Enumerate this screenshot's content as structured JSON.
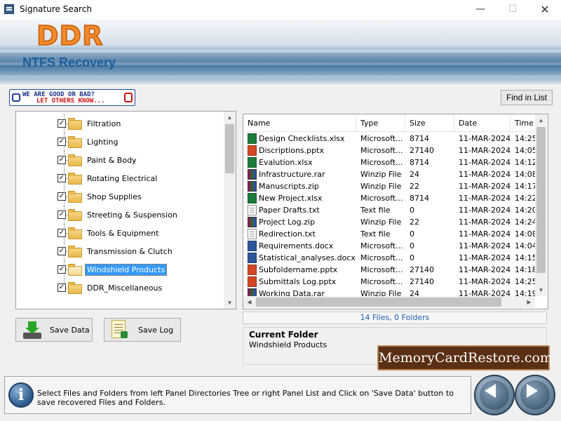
{
  "window": {
    "title": "Signature Search",
    "controls": {
      "minimize": "—",
      "maximize": "☐",
      "close": "✕"
    }
  },
  "banner": {
    "logo": "DDR",
    "subtitle": "NTFS Recovery"
  },
  "feedback": {
    "line1": "WE ARE GOOD OR BAD?",
    "line2": "LET OTHERS KNOW..."
  },
  "toolbar": {
    "find_label": "Find in List"
  },
  "tree": {
    "items": [
      {
        "label": "Filtration",
        "checked": true,
        "selected": false
      },
      {
        "label": "Lighting",
        "checked": true,
        "selected": false
      },
      {
        "label": "Paint & Body",
        "checked": true,
        "selected": false
      },
      {
        "label": "Rotating Electrical",
        "checked": true,
        "selected": false
      },
      {
        "label": "Shop Supplies",
        "checked": true,
        "selected": false
      },
      {
        "label": "Streeting & Suspension",
        "checked": true,
        "selected": false
      },
      {
        "label": "Tools & Equipment",
        "checked": true,
        "selected": false
      },
      {
        "label": "Transmission & Clutch",
        "checked": true,
        "selected": false
      },
      {
        "label": "Windshield Products",
        "checked": true,
        "selected": true
      },
      {
        "label": "DDR_Miscellaneous",
        "checked": true,
        "selected": false
      }
    ]
  },
  "file_list": {
    "columns": [
      "Name",
      "Type",
      "Size",
      "Date",
      "Time"
    ],
    "rows": [
      {
        "icon": "xlsx",
        "name": "Design Checklists.xlsx",
        "type": "Microsoft...",
        "size": "8714",
        "date": "11-MAR-2024",
        "time": "14:25"
      },
      {
        "icon": "pptx",
        "name": "Discriptions.pptx",
        "type": "Microsoft...",
        "size": "27140",
        "date": "11-MAR-2024",
        "time": "14:05"
      },
      {
        "icon": "xlsx",
        "name": "Evalution.xlsx",
        "type": "Microsoft...",
        "size": "8714",
        "date": "11-MAR-2024",
        "time": "14:12"
      },
      {
        "icon": "rar",
        "name": "Infrastructure.rar",
        "type": "Winzip File",
        "size": "24",
        "date": "11-MAR-2024",
        "time": "14:08"
      },
      {
        "icon": "zip",
        "name": "Manuscripts.zip",
        "type": "Winzip File",
        "size": "22",
        "date": "11-MAR-2024",
        "time": "14:17"
      },
      {
        "icon": "xlsx",
        "name": "New Project.xlsx",
        "type": "Microsoft...",
        "size": "8714",
        "date": "11-MAR-2024",
        "time": "14:22"
      },
      {
        "icon": "txt",
        "name": "Paper Drafts.txt",
        "type": "Text file",
        "size": "0",
        "date": "11-MAR-2024",
        "time": "14:20"
      },
      {
        "icon": "zip",
        "name": "Project Log.zip",
        "type": "Winzip File",
        "size": "22",
        "date": "11-MAR-2024",
        "time": "14:24"
      },
      {
        "icon": "txt",
        "name": "Redirection.txt",
        "type": "Text file",
        "size": "0",
        "date": "11-MAR-2024",
        "time": "14:08"
      },
      {
        "icon": "docx",
        "name": "Requirements.docx",
        "type": "Microsoft...",
        "size": "0",
        "date": "11-MAR-2024",
        "time": "14:04"
      },
      {
        "icon": "docx",
        "name": "Statistical_analyses.docx",
        "type": "Microsoft...",
        "size": "0",
        "date": "11-MAR-2024",
        "time": "14:15"
      },
      {
        "icon": "pptx",
        "name": "Subfoldername.pptx",
        "type": "Microsoft...",
        "size": "27140",
        "date": "11-MAR-2024",
        "time": "14:18"
      },
      {
        "icon": "pptx",
        "name": "Submittals Log.pptx",
        "type": "Microsoft...",
        "size": "27140",
        "date": "11-MAR-2024",
        "time": "14:25"
      },
      {
        "icon": "rar",
        "name": "Working Data.rar",
        "type": "Winzip File",
        "size": "24",
        "date": "11-MAR-2024",
        "time": "14:19"
      }
    ]
  },
  "status": {
    "summary": "14 Files, 0 Folders"
  },
  "current_folder": {
    "heading": "Current Folder",
    "value": "Windshield Products"
  },
  "actions": {
    "save_data": "Save Data",
    "save_log": "Save Log"
  },
  "brand": {
    "text": "MemoryCardRestore.com"
  },
  "info": {
    "text": "Select Files and Folders from left Panel Directories Tree or right Panel List and Click on 'Save Data' button to save recovered Files and Folders."
  },
  "colors": {
    "accent": "#1d5f9a",
    "selection": "#3399ff",
    "logo": "#f08a2a",
    "status_text": "#1f5fb0",
    "brand_bg": "#5a2f14"
  }
}
